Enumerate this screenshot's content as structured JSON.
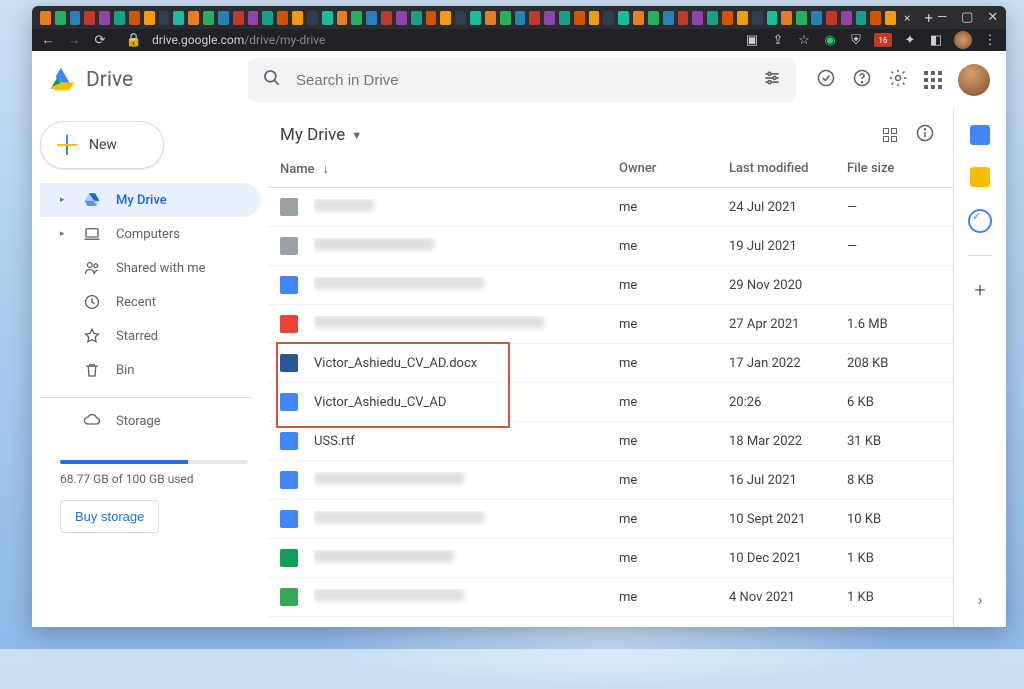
{
  "chrome": {
    "url_host": "drive.google.com",
    "url_path": "/drive/my-drive",
    "ext_badge": "16"
  },
  "app": {
    "product": "Drive",
    "search_placeholder": "Search in Drive"
  },
  "newbtn": {
    "label": "New"
  },
  "nav": {
    "items": [
      {
        "label": "My Drive",
        "active": true,
        "caret": true,
        "icon": "drive"
      },
      {
        "label": "Computers",
        "caret": true,
        "icon": "laptop"
      },
      {
        "label": "Shared with me",
        "icon": "people"
      },
      {
        "label": "Recent",
        "icon": "clock"
      },
      {
        "label": "Starred",
        "icon": "star"
      },
      {
        "label": "Bin",
        "icon": "trash"
      }
    ],
    "storage_label": "Storage",
    "storage_used_pct": 68,
    "storage_text": "68.77 GB of 100 GB used",
    "buy": "Buy storage"
  },
  "main": {
    "breadcrumb": "My Drive",
    "cols": {
      "name": "Name",
      "owner": "Owner",
      "mod": "Last modified",
      "size": "File size"
    }
  },
  "files": [
    {
      "blur": true,
      "blurW": 60,
      "icon": "folder",
      "owner": "me",
      "mod": "24 Jul 2021",
      "size": "—"
    },
    {
      "blur": true,
      "blurW": 120,
      "icon": "folder",
      "owner": "me",
      "mod": "19 Jul 2021",
      "size": "—"
    },
    {
      "blur": true,
      "blurW": 170,
      "icon": "doc",
      "owner": "me",
      "mod": "29 Nov 2020",
      "size": ""
    },
    {
      "blur": true,
      "blurW": 230,
      "icon": "pdf",
      "owner": "me",
      "mod": "27 Apr 2021",
      "size": "1.6 MB"
    },
    {
      "name": "Victor_Ashiedu_CV_AD.docx",
      "icon": "word",
      "owner": "me",
      "mod": "17 Jan 2022",
      "size": "208 KB",
      "hl": true
    },
    {
      "name": "Victor_Ashiedu_CV_AD",
      "icon": "doc",
      "owner": "me",
      "mod": "20:26",
      "size": "6 KB",
      "hl": true
    },
    {
      "name": "USS.rtf",
      "icon": "file",
      "owner": "me",
      "mod": "18 Mar 2022",
      "size": "31 KB"
    },
    {
      "blur": true,
      "blurW": 150,
      "icon": "doc",
      "owner": "me",
      "mod": "16 Jul 2021",
      "size": "8 KB"
    },
    {
      "blur": true,
      "blurW": 170,
      "icon": "doc",
      "owner": "me",
      "mod": "10 Sept 2021",
      "size": "10 KB"
    },
    {
      "blur": true,
      "blurW": 140,
      "icon": "sheet",
      "owner": "me",
      "mod": "10 Dec 2021",
      "size": "1 KB"
    },
    {
      "blur": true,
      "blurW": 150,
      "icon": "gsheet",
      "owner": "me",
      "mod": "4 Nov 2021",
      "size": "1 KB"
    }
  ]
}
